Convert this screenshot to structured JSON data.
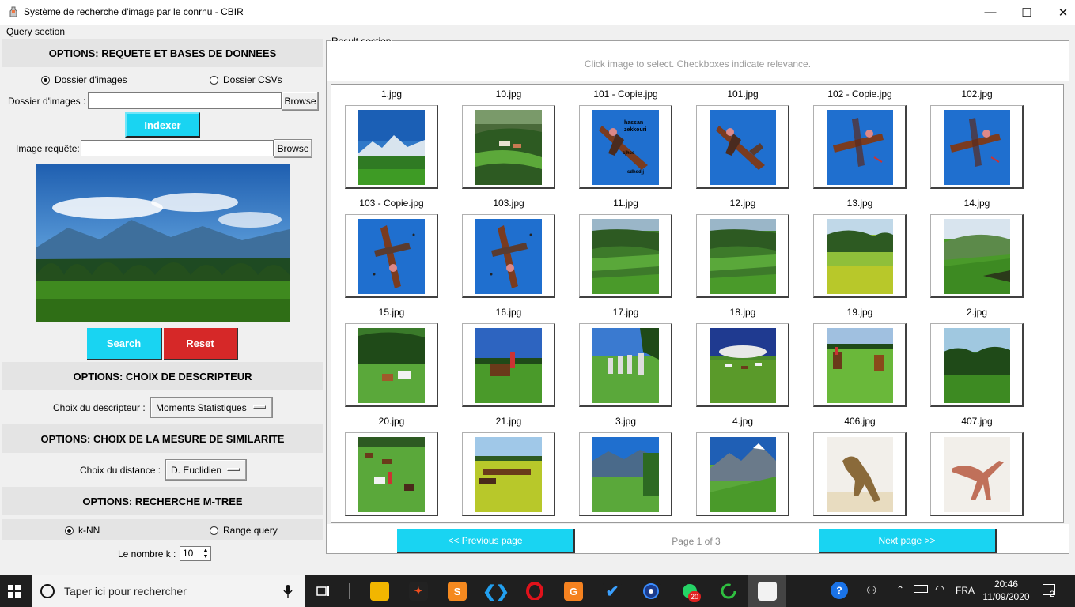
{
  "window": {
    "title": "Système de recherche d'image par le conrnu - CBIR",
    "minimize": "—",
    "maximize": "☐",
    "close": "✕"
  },
  "query": {
    "group_label": "Query section",
    "options_header": "OPTIONS: REQUETE ET BASES DE DONNEES",
    "radio_images": "Dossier d'images",
    "radio_csvs": "Dossier CSVs",
    "folder_label": "Dossier d'images :",
    "folder_value": "",
    "browse_label": "Browse",
    "index_label": "Indexer",
    "query_label": "Image requête:",
    "query_value": "",
    "browse2_label": "Browse",
    "search_label": "Search",
    "reset_label": "Reset",
    "descriptor_header": "OPTIONS: CHOIX DE DESCRIPTEUR",
    "descriptor_label": "Choix du descripteur :",
    "descriptor_value": "Moments Statistiques",
    "similarity_header": "OPTIONS: CHOIX DE LA MESURE DE SIMILARITE",
    "distance_label": "Choix du distance :",
    "distance_value": "D. Euclidien",
    "mtree_header": "OPTIONS: RECHERCHE M-TREE",
    "radio_knn": "k-NN",
    "radio_range": "Range query",
    "k_label": "Le nombre k :",
    "k_value": "10"
  },
  "result": {
    "group_label": "Result section",
    "hint": "Click image to select. Checkboxes indicate relevance.",
    "prev_label": "<< Previous page",
    "page_label": "Page 1 of 3",
    "next_label": "Next page >>",
    "thumbnails": [
      {
        "label": "1.jpg",
        "kind": "mountain"
      },
      {
        "label": "10.jpg",
        "kind": "village"
      },
      {
        "label": "101 - Copie.jpg",
        "kind": "plane-text"
      },
      {
        "label": "101.jpg",
        "kind": "plane"
      },
      {
        "label": "102 - Copie.jpg",
        "kind": "plane-flat"
      },
      {
        "label": "102.jpg",
        "kind": "plane-flat"
      },
      {
        "label": "103 - Copie.jpg",
        "kind": "plane-down"
      },
      {
        "label": "103.jpg",
        "kind": "plane-down"
      },
      {
        "label": "11.jpg",
        "kind": "fields"
      },
      {
        "label": "12.jpg",
        "kind": "fields"
      },
      {
        "label": "13.jpg",
        "kind": "meadow"
      },
      {
        "label": "14.jpg",
        "kind": "hills"
      },
      {
        "label": "15.jpg",
        "kind": "horses"
      },
      {
        "label": "16.jpg",
        "kind": "rider"
      },
      {
        "label": "17.jpg",
        "kind": "stones"
      },
      {
        "label": "18.jpg",
        "kind": "herd"
      },
      {
        "label": "19.jpg",
        "kind": "riders"
      },
      {
        "label": "2.jpg",
        "kind": "forest"
      },
      {
        "label": "20.jpg",
        "kind": "cows"
      },
      {
        "label": "21.jpg",
        "kind": "cattle"
      },
      {
        "label": "3.jpg",
        "kind": "jungle"
      },
      {
        "label": "4.jpg",
        "kind": "alps"
      },
      {
        "label": "406.jpg",
        "kind": "dino"
      },
      {
        "label": "407.jpg",
        "kind": "dino2"
      }
    ],
    "plane_text_lines": [
      "hassan",
      "zekkouri",
      "sjhcs",
      "sdhsdjj"
    ]
  },
  "taskbar": {
    "search_placeholder": "Taper ici pour rechercher",
    "language": "FRA",
    "time": "20:46",
    "date": "11/09/2020",
    "whatsapp_badge": "20",
    "notification_count": "2"
  },
  "colors": {
    "cyan_button": "#19d4f2",
    "red_button": "#d62828",
    "taskbar": "#1f1f1f"
  }
}
